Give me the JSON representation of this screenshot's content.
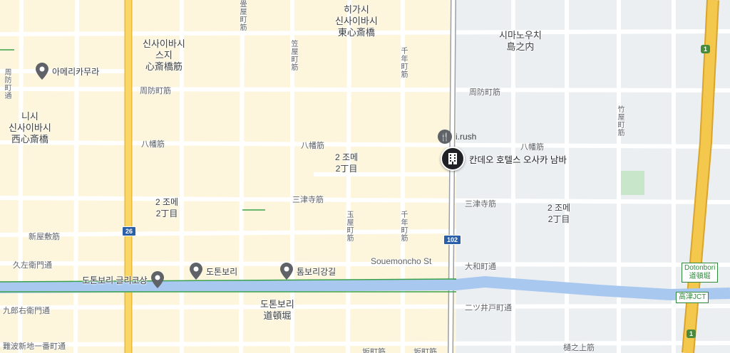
{
  "districts": [
    {
      "id": "higashi",
      "lines": [
        "히가시",
        "신사이바시",
        "東心斎橋"
      ]
    },
    {
      "id": "shimanouchi",
      "lines": [
        "시마노우치",
        "島之内"
      ]
    },
    {
      "id": "shinsaibashisuji",
      "lines": [
        "신사이바시",
        "스지",
        "心斎橋筋"
      ]
    },
    {
      "id": "nishi",
      "lines": [
        "니시",
        "신사이바시",
        "西心斎橋"
      ]
    },
    {
      "id": "dotonbori",
      "lines": [
        "도톤보리",
        "道頓堀"
      ]
    },
    {
      "id": "chome2a",
      "lines": [
        "2 조메",
        "2丁目"
      ]
    },
    {
      "id": "chome2b",
      "lines": [
        "2 조메",
        "2丁目"
      ]
    },
    {
      "id": "chome2c",
      "lines": [
        "2 조메",
        "2丁目"
      ]
    }
  ],
  "streets": {
    "suomachi_w": "周防町筋",
    "suomachi_e": "周防町筋",
    "yawata_w": "八幡筋",
    "yawata_m": "八幡筋",
    "yawata_e": "八幡筋",
    "mitsudera_m": "三津寺筋",
    "mitsudera_e": "三津寺筋",
    "shinyashiki": "新屋敷筋",
    "kyuzaemon": "久左衛門通",
    "kurouemon": "九郎右衛門通",
    "souemoncho": "Souemoncho St",
    "yamato": "大和町通",
    "futatsuido": "二ツ井戸町通",
    "namba_shinchi": "難波新地一番町通",
    "hinouekami": "樋之上筋",
    "sennichi_n": "千年町筋",
    "sennichi_s": "千年町筋",
    "kasaya": "笠屋町筋",
    "tama": "玉屋町筋",
    "take": "竹屋町筋",
    "shuyamachi": "周防町通",
    "suomachi_top": "畳屋町筋",
    "bottom_a": "坂町筋",
    "bottom_b": "坂町筋"
  },
  "pois": [
    {
      "id": "amerikamura",
      "name": "아메리카무라"
    },
    {
      "id": "glico",
      "name": "도톤보리 글리코상"
    },
    {
      "id": "dotonbori_poi",
      "name": "도톤보리"
    },
    {
      "id": "tombori",
      "name": "톰보리강길"
    }
  ],
  "restaurant": {
    "name": "i.rush",
    "icon": "fork-knife-icon"
  },
  "hotel": {
    "name": "칸데오 호텔스 오사카 남바",
    "icon": "hotel-building-icon"
  },
  "route_shields": [
    {
      "id": "r26",
      "label": "26"
    },
    {
      "id": "r102",
      "label": "102"
    }
  ],
  "expressway_shields": [
    {
      "id": "e1a",
      "label": "1"
    },
    {
      "id": "e1b",
      "label": "1"
    }
  ],
  "junctions": [
    {
      "id": "dotonbori_jct",
      "lines": [
        "Dotonbori",
        "道頓堀"
      ]
    },
    {
      "id": "takatsu",
      "lines": [
        "高津JCT"
      ]
    }
  ],
  "colors": {
    "land": "#f3efe3",
    "block": "#fdf6dd",
    "road": "#ffffff",
    "major_road": "#fcd664",
    "expressway": "#f4c74d",
    "river": "#a8c8f0",
    "transit": "#3aa14a",
    "park": "#c8e6c9",
    "block_grey": "#eceff1"
  }
}
